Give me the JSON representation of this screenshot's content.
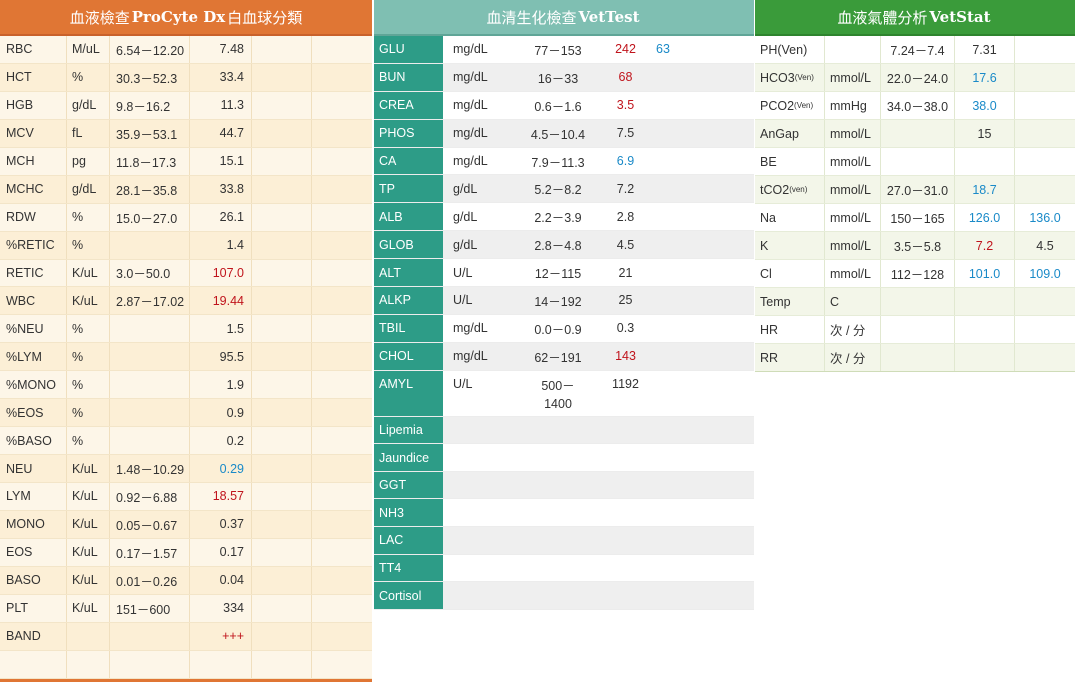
{
  "colors": {
    "high": "#c0141c",
    "low": "#1a8ac8",
    "cbc_header": "#e07634",
    "chem_header": "#7fbfb2",
    "chem_label": "#2d9c87",
    "gas_header": "#3a9b3a"
  },
  "cbc": {
    "title_pre": "血液檢查",
    "title_bold": "ProCyte Dx",
    "title_post": "白血球分類",
    "rows": [
      {
        "name": "RBC",
        "unit": "M/uL",
        "range": "6.54－12.20",
        "value": "7.48",
        "flag": ""
      },
      {
        "name": "HCT",
        "unit": "%",
        "range": "30.3－52.3",
        "value": "33.4",
        "flag": ""
      },
      {
        "name": "HGB",
        "unit": "g/dL",
        "range": "9.8－16.2",
        "value": "11.3",
        "flag": ""
      },
      {
        "name": "MCV",
        "unit": "fL",
        "range": "35.9－53.1",
        "value": "44.7",
        "flag": ""
      },
      {
        "name": "MCH",
        "unit": "pg",
        "range": "11.8－17.3",
        "value": "15.1",
        "flag": ""
      },
      {
        "name": "MCHC",
        "unit": "g/dL",
        "range": "28.1－35.8",
        "value": "33.8",
        "flag": ""
      },
      {
        "name": "RDW",
        "unit": "%",
        "range": "15.0－27.0",
        "value": "26.1",
        "flag": ""
      },
      {
        "name": "%RETIC",
        "unit": "%",
        "range": "",
        "value": "1.4",
        "flag": ""
      },
      {
        "name": "RETIC",
        "unit": "K/uL",
        "range": "3.0－50.0",
        "value": "107.0",
        "flag": "high"
      },
      {
        "name": "WBC",
        "unit": "K/uL",
        "range": "2.87－17.02",
        "value": "19.44",
        "flag": "high"
      },
      {
        "name": "%NEU",
        "unit": "%",
        "range": "",
        "value": "1.5",
        "flag": ""
      },
      {
        "name": "%LYM",
        "unit": "%",
        "range": "",
        "value": "95.5",
        "flag": ""
      },
      {
        "name": "%MONO",
        "unit": "%",
        "range": "",
        "value": "1.9",
        "flag": ""
      },
      {
        "name": "%EOS",
        "unit": "%",
        "range": "",
        "value": "0.9",
        "flag": ""
      },
      {
        "name": "%BASO",
        "unit": "%",
        "range": "",
        "value": "0.2",
        "flag": ""
      },
      {
        "name": "NEU",
        "unit": "K/uL",
        "range": "1.48－10.29",
        "value": "0.29",
        "flag": "low"
      },
      {
        "name": "LYM",
        "unit": "K/uL",
        "range": "0.92－6.88",
        "value": "18.57",
        "flag": "high"
      },
      {
        "name": "MONO",
        "unit": "K/uL",
        "range": "0.05－0.67",
        "value": "0.37",
        "flag": ""
      },
      {
        "name": "EOS",
        "unit": "K/uL",
        "range": "0.17－1.57",
        "value": "0.17",
        "flag": ""
      },
      {
        "name": "BASO",
        "unit": "K/uL",
        "range": "0.01－0.26",
        "value": "0.04",
        "flag": ""
      },
      {
        "name": "PLT",
        "unit": "K/uL",
        "range": "151－600",
        "value": "334",
        "flag": ""
      },
      {
        "name": "BAND",
        "unit": "",
        "range": "",
        "value": "+++",
        "flag": "high"
      },
      {
        "name": "",
        "unit": "",
        "range": "",
        "value": "",
        "flag": ""
      }
    ]
  },
  "chem": {
    "title_pre": "血清生化檢查",
    "title_bold": "VetTest",
    "rows": [
      {
        "name": "GLU",
        "unit": "mg/dL",
        "range": "77－153",
        "value": "242",
        "flag": "high",
        "value2": "63",
        "flag2": "low"
      },
      {
        "name": "BUN",
        "unit": "mg/dL",
        "range": "16－33",
        "value": "68",
        "flag": "high",
        "value2": "",
        "flag2": ""
      },
      {
        "name": "CREA",
        "unit": "mg/dL",
        "range": "0.6－1.6",
        "value": "3.5",
        "flag": "high",
        "value2": "",
        "flag2": ""
      },
      {
        "name": "PHOS",
        "unit": "mg/dL",
        "range": "4.5－10.4",
        "value": "7.5",
        "flag": "",
        "value2": "",
        "flag2": ""
      },
      {
        "name": "CA",
        "unit": "mg/dL",
        "range": "7.9－11.3",
        "value": "6.9",
        "flag": "low",
        "value2": "",
        "flag2": ""
      },
      {
        "name": "TP",
        "unit": "g/dL",
        "range": "5.2－8.2",
        "value": "7.2",
        "flag": "",
        "value2": "",
        "flag2": ""
      },
      {
        "name": "ALB",
        "unit": "g/dL",
        "range": "2.2－3.9",
        "value": "2.8",
        "flag": "",
        "value2": "",
        "flag2": ""
      },
      {
        "name": "GLOB",
        "unit": "g/dL",
        "range": "2.8－4.8",
        "value": "4.5",
        "flag": "",
        "value2": "",
        "flag2": ""
      },
      {
        "name": "ALT",
        "unit": "U/L",
        "range": "12－115",
        "value": "21",
        "flag": "",
        "value2": "",
        "flag2": ""
      },
      {
        "name": "ALKP",
        "unit": "U/L",
        "range": "14－192",
        "value": "25",
        "flag": "",
        "value2": "",
        "flag2": ""
      },
      {
        "name": "TBIL",
        "unit": "mg/dL",
        "range": "0.0－0.9",
        "value": "0.3",
        "flag": "",
        "value2": "",
        "flag2": ""
      },
      {
        "name": "CHOL",
        "unit": "mg/dL",
        "range": "62－191",
        "value": "143",
        "flag": "high",
        "value2": "",
        "flag2": ""
      }
    ],
    "amyl": {
      "name": "AMYL",
      "unit": "U/L",
      "range_a": "500－",
      "range_b": "1400",
      "value": "1192"
    },
    "extra": [
      "Lipemia",
      "Jaundice",
      "GGT",
      "NH3",
      "LAC",
      "TT4",
      "Cortisol"
    ]
  },
  "gas": {
    "title_pre": "血液氣體分析",
    "title_bold": "VetStat",
    "rows": [
      {
        "name": "PH",
        "sub": "",
        "suffix": "(Ven)",
        "unit": "",
        "range": "7.24－7.4",
        "value": "7.31",
        "flag": "",
        "value2": "",
        "flag2": ""
      },
      {
        "name": "HCO3",
        "sub": "(Ven)",
        "suffix": "",
        "unit": "mmol/L",
        "range": "22.0－24.0",
        "value": "17.6",
        "flag": "low",
        "value2": "",
        "flag2": ""
      },
      {
        "name": "PCO2",
        "sub": "(Ven)",
        "suffix": "",
        "unit": "mmHg",
        "range": "34.0－38.0",
        "value": "38.0",
        "flag": "low",
        "value2": "",
        "flag2": ""
      },
      {
        "name": "AnGap",
        "sub": "",
        "suffix": "",
        "unit": "mmol/L",
        "range": "",
        "value": "15",
        "flag": "",
        "value2": "",
        "flag2": ""
      },
      {
        "name": "BE",
        "sub": "",
        "suffix": "",
        "unit": "mmol/L",
        "range": "",
        "value": "",
        "flag": "",
        "value2": "",
        "flag2": ""
      },
      {
        "name": "tCO2",
        "sub": "(ven)",
        "suffix": "",
        "unit": "mmol/L",
        "range": "27.0－31.0",
        "value": "18.7",
        "flag": "low",
        "value2": "",
        "flag2": ""
      },
      {
        "name": "Na",
        "sub": "",
        "suffix": "",
        "unit": "mmol/L",
        "range": "150－165",
        "value": "126.0",
        "flag": "low",
        "value2": "136.0",
        "flag2": "low"
      },
      {
        "name": "K",
        "sub": "",
        "suffix": "",
        "unit": "mmol/L",
        "range": "3.5－5.8",
        "value": "7.2",
        "flag": "high",
        "value2": "4.5",
        "flag2": ""
      },
      {
        "name": "Cl",
        "sub": "",
        "suffix": "",
        "unit": "mmol/L",
        "range": "112－128",
        "value": "101.0",
        "flag": "low",
        "value2": "109.0",
        "flag2": "low"
      },
      {
        "name": "Temp",
        "sub": "",
        "suffix": "",
        "unit": "C",
        "range": "",
        "value": "",
        "flag": "",
        "value2": "",
        "flag2": ""
      },
      {
        "name": "HR",
        "sub": "",
        "suffix": "",
        "unit": "次 / 分",
        "range": "",
        "value": "",
        "flag": "",
        "value2": "",
        "flag2": ""
      },
      {
        "name": "RR",
        "sub": "",
        "suffix": "",
        "unit": "次 / 分",
        "range": "",
        "value": "",
        "flag": "",
        "value2": "",
        "flag2": ""
      }
    ]
  }
}
